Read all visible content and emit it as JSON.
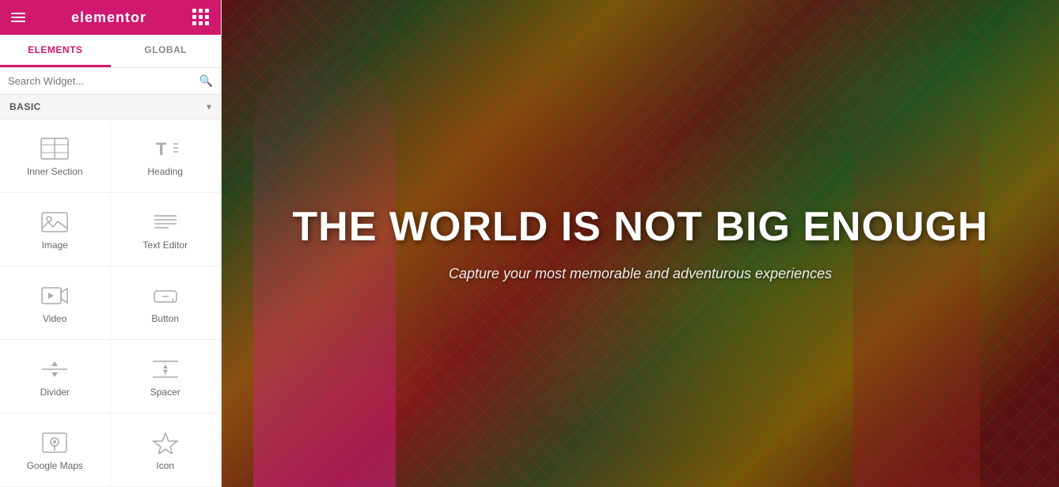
{
  "topbar": {
    "logo": "elementor",
    "hamburger_label": "menu",
    "grid_label": "apps"
  },
  "tabs": [
    {
      "id": "elements",
      "label": "ELEMENTS",
      "active": true
    },
    {
      "id": "global",
      "label": "GLOBAL",
      "active": false
    }
  ],
  "search": {
    "placeholder": "Search Widget..."
  },
  "section": {
    "label": "BASIC",
    "arrow": "▾"
  },
  "widgets": [
    {
      "id": "inner-section",
      "label": "Inner Section",
      "icon": "inner-section-icon"
    },
    {
      "id": "heading",
      "label": "Heading",
      "icon": "heading-icon"
    },
    {
      "id": "image",
      "label": "Image",
      "icon": "image-icon"
    },
    {
      "id": "text-editor",
      "label": "Text Editor",
      "icon": "text-editor-icon"
    },
    {
      "id": "video",
      "label": "Video",
      "icon": "video-icon"
    },
    {
      "id": "button",
      "label": "Button",
      "icon": "button-icon"
    },
    {
      "id": "divider",
      "label": "Divider",
      "icon": "divider-icon"
    },
    {
      "id": "spacer",
      "label": "Spacer",
      "icon": "spacer-icon"
    },
    {
      "id": "google-maps",
      "label": "Google Maps",
      "icon": "google-maps-icon"
    },
    {
      "id": "icon",
      "label": "Icon",
      "icon": "icon-icon"
    }
  ],
  "canvas": {
    "main_heading": "THE WORLD IS NOT BIG ENOUGH",
    "sub_heading": "Capture your most memorable and adventurous experiences"
  },
  "collapse": {
    "arrow": "‹"
  }
}
